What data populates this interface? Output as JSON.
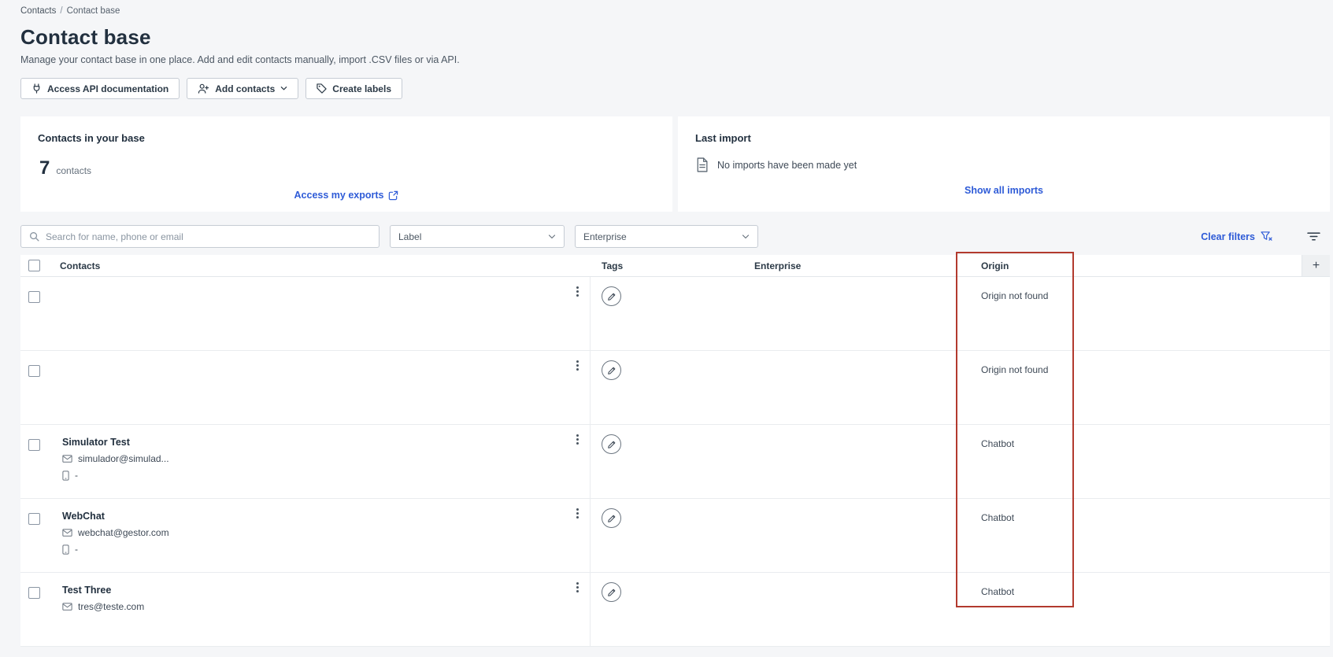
{
  "breadcrumb": {
    "items": [
      {
        "label": "Contacts"
      },
      {
        "label": "Contact base"
      }
    ],
    "separator": "/"
  },
  "header": {
    "title": "Contact base",
    "subtitle": "Manage your contact base in one place. Add and edit contacts manually, import .CSV files or via API."
  },
  "toolbar": {
    "access_api": "Access API documentation",
    "add_contacts": "Add contacts",
    "create_labels": "Create labels"
  },
  "summary": {
    "contacts_card": {
      "title": "Contacts in your base",
      "count": "7",
      "count_unit": "contacts",
      "exports_link": "Access my exports"
    },
    "import_card": {
      "title": "Last import",
      "empty_message": "No imports have been made yet",
      "show_all_link": "Show all imports"
    }
  },
  "filters": {
    "search_placeholder": "Search for name, phone or email",
    "label_select": "Label",
    "enterprise_select": "Enterprise",
    "clear_filters": "Clear filters"
  },
  "table": {
    "header": {
      "contacts": "Contacts",
      "tags": "Tags",
      "enterprise": "Enterprise",
      "origin": "Origin",
      "add_column": "+"
    },
    "rows": [
      {
        "name": "",
        "email": "",
        "phone": "",
        "origin": "Origin not found"
      },
      {
        "name": "",
        "email": "",
        "phone": "",
        "origin": "Origin not found"
      },
      {
        "name": "Simulator Test",
        "email": "simulador@simulad...",
        "phone": "-",
        "origin": "Chatbot"
      },
      {
        "name": "WebChat",
        "email": "webchat@gestor.com",
        "phone": "-",
        "origin": "Chatbot"
      },
      {
        "name": "Test Three",
        "email": "tres@teste.com",
        "phone": "",
        "origin": "Chatbot"
      }
    ]
  },
  "colors": {
    "accent_blue": "#2e5bd7",
    "annotation_red": "#b23a2e",
    "text_dark": "#22303f"
  }
}
